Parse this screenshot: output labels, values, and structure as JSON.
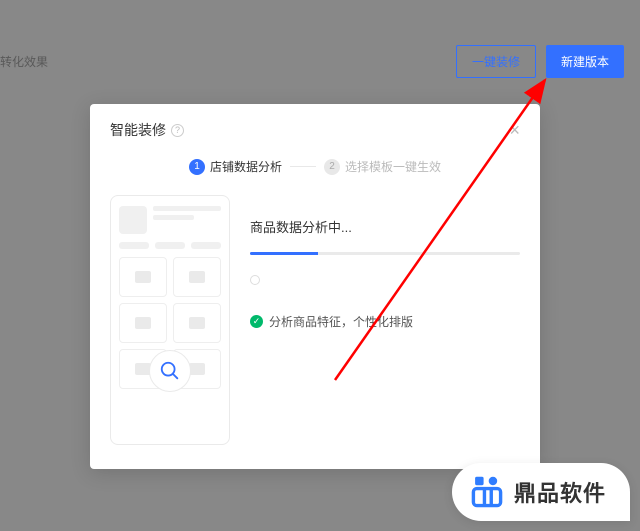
{
  "sidebar": {
    "label": "转化效果"
  },
  "header": {
    "btn_outline": "一键装修",
    "btn_primary": "新建版本"
  },
  "modal": {
    "title": "智能装修",
    "steps": {
      "step1": "店铺数据分析",
      "step2": "选择模板一键生效"
    },
    "progress_title": "商品数据分析中...",
    "hint_text": "",
    "success_text": "分析商品特征，个性化排版"
  },
  "brand": {
    "name": "鼎品软件"
  }
}
